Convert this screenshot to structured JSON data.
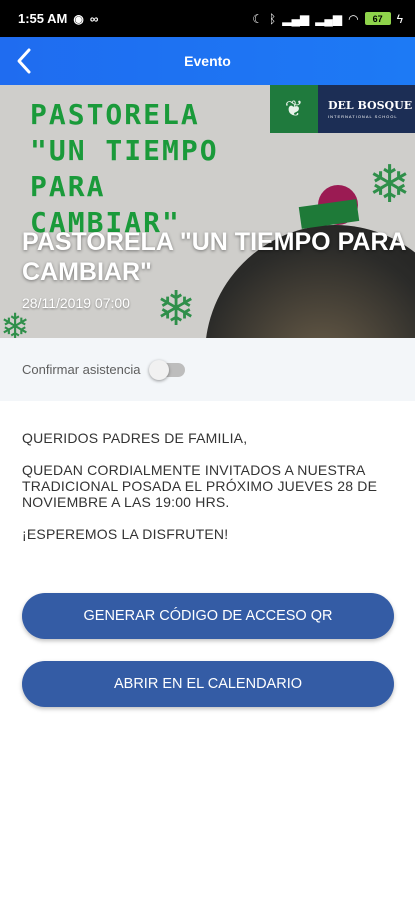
{
  "status_bar": {
    "time": "1:55 AM",
    "battery": "67"
  },
  "app_bar": {
    "title": "Evento"
  },
  "hero": {
    "poster_lines": [
      "PASTORELA",
      "\"UN TIEMPO",
      "PARA",
      "CAMBIAR\""
    ],
    "logo_brand": "DEL BOSQUE",
    "logo_sub": "INTERNATIONAL SCHOOL",
    "title": "PASTORELA \"UN TIEMPO PARA CAMBIAR\"",
    "date": "28/11/2019 07:00"
  },
  "confirm": {
    "label": "Confirmar asistencia",
    "enabled": false
  },
  "message": {
    "paragraphs": [
      "QUERIDOS PADRES DE FAMILIA,",
      "QUEDAN CORDIALMENTE INVITADOS A NUESTRA TRADICIONAL POSADA EL PRÓXIMO JUEVES 28 DE NOVIEMBRE A LAS 19:00 HRS.",
      "¡ESPEREMOS LA DISFRUTEN!"
    ]
  },
  "buttons": {
    "qr_label": "GENERAR CÓDIGO DE ACCESO QR",
    "calendar_label": "ABRIR EN EL CALENDARIO"
  },
  "icons": {
    "back": "chevron-left-icon",
    "toggle": "toggle-off"
  }
}
